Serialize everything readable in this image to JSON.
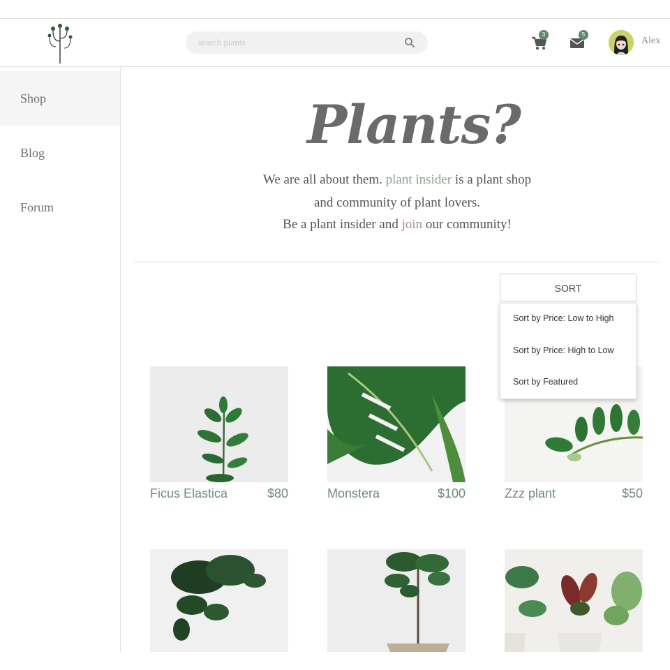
{
  "header": {
    "search_placeholder": "search plants",
    "cart_count": "3",
    "messages_count": "5",
    "user_name": "Alex"
  },
  "sidebar": {
    "items": [
      {
        "label": "Shop",
        "active": true
      },
      {
        "label": "Blog",
        "active": false
      },
      {
        "label": "Forum",
        "active": false
      }
    ]
  },
  "hero": {
    "title": "Plants?",
    "line1_a": "We are all about them.",
    "line1_link": "plant insider",
    "line1_b": "is a plant shop",
    "line2": "and community of plant lovers.",
    "line3_a": "Be a plant insider and",
    "line3_link": "join",
    "line3_b": "our community!"
  },
  "sort": {
    "label": "SORT",
    "options": [
      "Sort by Price: Low to High",
      "Sort by Price: High to Low",
      "Sort by Featured"
    ]
  },
  "products": [
    {
      "name": "Ficus Elastica",
      "price": "$80"
    },
    {
      "name": "Monstera",
      "price": "$100"
    },
    {
      "name": "Zzz plant",
      "price": "$50"
    }
  ],
  "colors": {
    "accent_green": "#8aa58f",
    "accent_pink": "#b08a8f",
    "badge": "#5d8a6a",
    "product_text": "#6f8a7e"
  }
}
